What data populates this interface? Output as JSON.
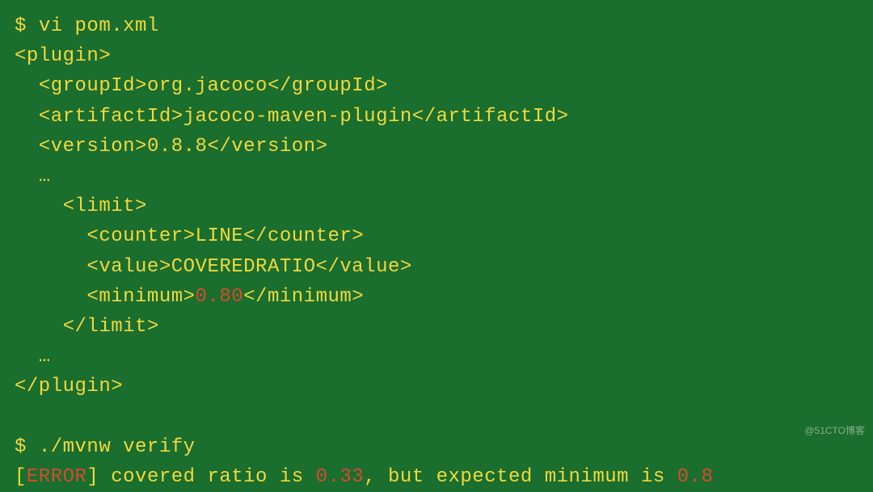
{
  "prompt": {
    "symbol": "$",
    "cmd1": "vi pom.xml",
    "cmd2": "./mvnw verify"
  },
  "xml": {
    "plugin_open": "<plugin>",
    "groupId_open": "  <groupId>",
    "groupId_val": "org.jacoco",
    "groupId_close": "</groupId>",
    "artifactId_open": "  <artifactId>",
    "artifactId_val": "jacoco-maven-plugin",
    "artifactId_close": "</artifactId>",
    "version_open": "  <version>",
    "version_val": "0.8.8",
    "version_close": "</version>",
    "ellipsis1": "  …",
    "limit_open": "    <limit>",
    "counter_open": "      <counter>",
    "counter_val": "LINE",
    "counter_close": "</counter>",
    "value_open": "      <value>",
    "value_val": "COVEREDRATIO",
    "value_close": "</value>",
    "minimum_open": "      <minimum>",
    "minimum_val": "0.80",
    "minimum_close": "</minimum>",
    "limit_close": "    </limit>",
    "ellipsis2": "  …",
    "plugin_close": "</plugin>"
  },
  "output": {
    "open_bracket": "[",
    "error_word": "ERROR",
    "close_bracket": "]",
    "msg1": " covered ratio is ",
    "ratio_actual": "0.33",
    "msg2": ", but expected minimum is ",
    "ratio_min": "0.8"
  },
  "watermark": "@51CTO博客"
}
